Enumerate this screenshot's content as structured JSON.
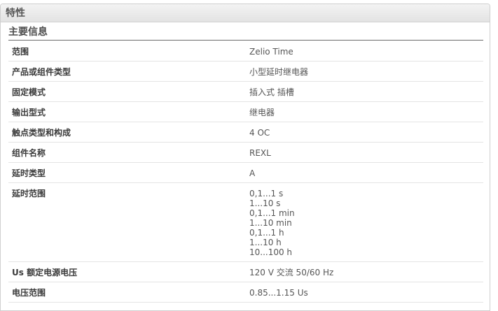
{
  "panel": {
    "title": "特性",
    "section_title": "主要信息"
  },
  "rows": [
    {
      "label": "范围",
      "values": [
        "Zelio Time"
      ]
    },
    {
      "label": "产品或组件类型",
      "values": [
        "小型延时继电器"
      ]
    },
    {
      "label": "固定模式",
      "values": [
        "插入式 插槽"
      ]
    },
    {
      "label": "输出型式",
      "values": [
        "继电器"
      ]
    },
    {
      "label": "触点类型和构成",
      "values": [
        "4 OC"
      ]
    },
    {
      "label": "组件名称",
      "values": [
        "REXL"
      ]
    },
    {
      "label": "延时类型",
      "values": [
        "A"
      ]
    },
    {
      "label": "延时范围",
      "values": [
        "0,1...1 s",
        "1...10 s",
        "0,1...1 min",
        "1...10 min",
        "0,1...1 h",
        "1...10 h",
        "10...100 h"
      ]
    },
    {
      "label": "Us 额定电源电压",
      "values": [
        "120 V 交流 50/60 Hz"
      ]
    },
    {
      "label": "电压范围",
      "values": [
        "0.85...1.15 Us"
      ]
    }
  ]
}
